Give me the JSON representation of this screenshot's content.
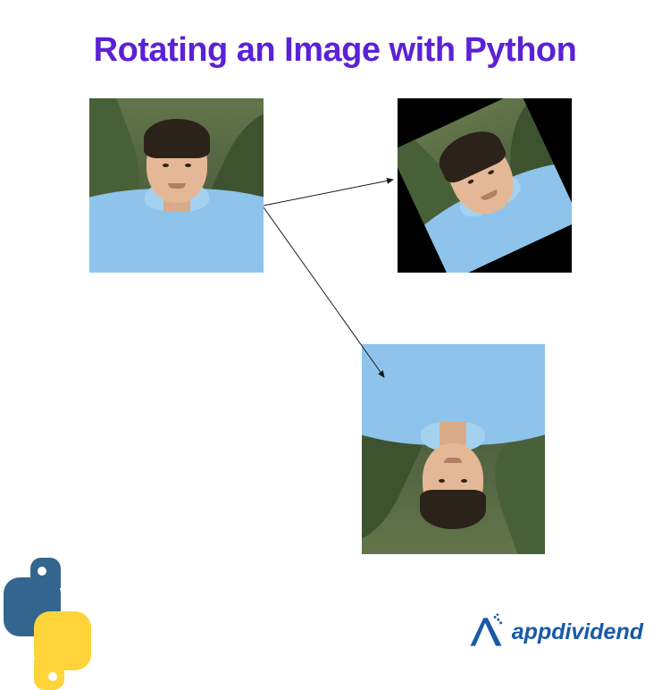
{
  "title": "Rotating an Image with Python",
  "images": {
    "original": {
      "label": "original-portrait",
      "rotation_deg": 0
    },
    "rotated_small": {
      "label": "rotated-portrait",
      "rotation_deg": -25
    },
    "rotated_180": {
      "label": "flipped-portrait",
      "rotation_deg": 180
    }
  },
  "arrows": [
    {
      "from": "original",
      "to": "rotated_small"
    },
    {
      "from": "original",
      "to": "rotated_180"
    }
  ],
  "logos": {
    "bottom_left": "python-logo",
    "bottom_right_text": "appdividend"
  },
  "colors": {
    "title": "#5B21D6",
    "brand": "#1959a8",
    "hoodie": "#8ec4eb"
  }
}
